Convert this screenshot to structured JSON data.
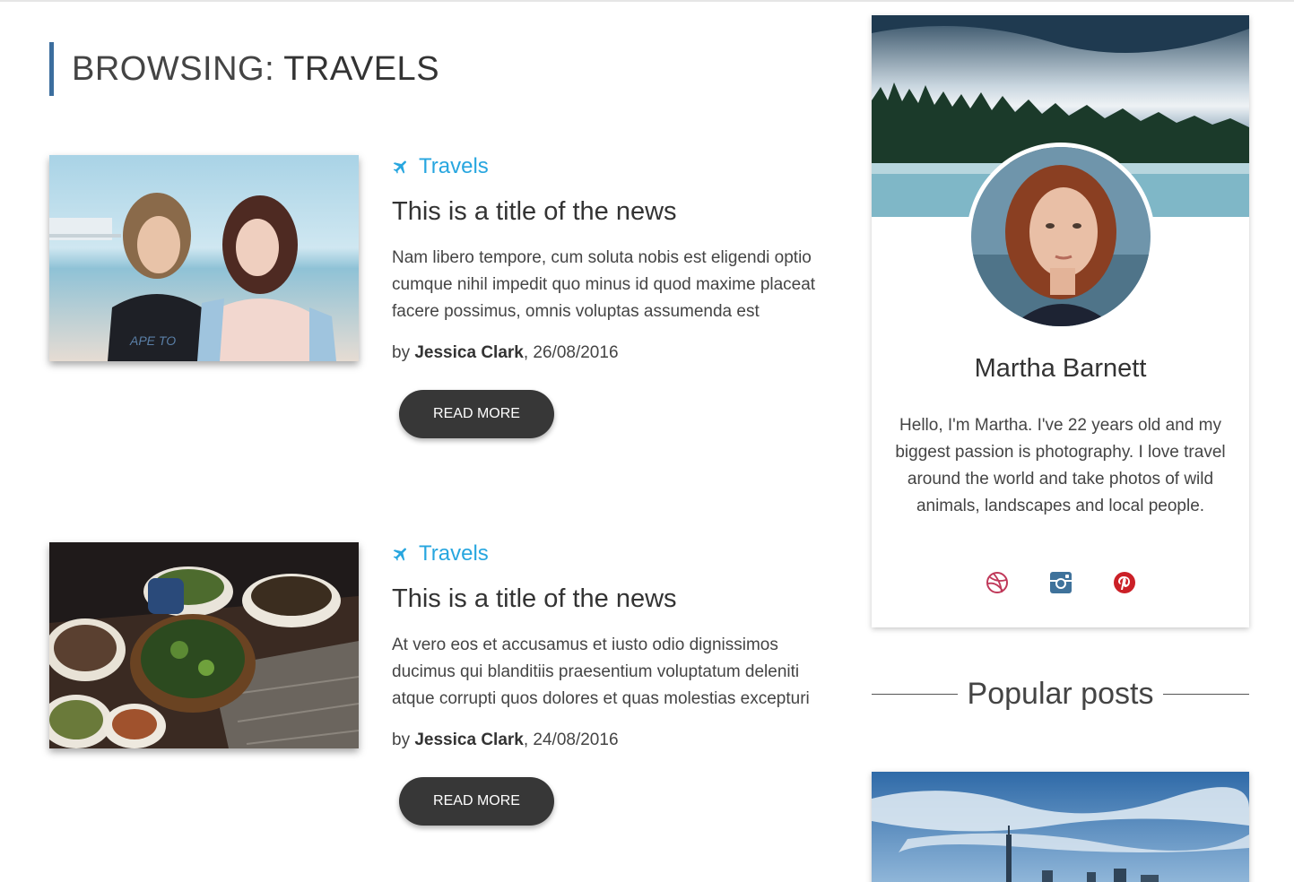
{
  "header": {
    "prefix": "BROWSING:",
    "term": "TRAVELS"
  },
  "posts": [
    {
      "category": "Travels",
      "category_icon": "airplane-icon",
      "title": "This is a title of the news",
      "excerpt": "Nam libero tempore, cum soluta nobis est eligendi optio cumque nihil impedit quo minus id quod maxime placeat facere possimus, omnis voluptas assumenda est",
      "by": "by",
      "author": "Jessica Clark",
      "date": ", 26/08/2016",
      "button": "READ MORE",
      "image": "two-women-beach-photo"
    },
    {
      "category": "Travels",
      "category_icon": "airplane-icon",
      "title": "This is a title of the news",
      "excerpt": "At vero eos et accusamus et iusto odio dignissimos ducimus qui blanditiis praesentium voluptatum deleniti atque corrupti quos dolores et quas molestias excepturi",
      "by": "by",
      "author": "Jessica Clark",
      "date": ", 24/08/2016",
      "button": "READ MORE",
      "image": "food-table-photo"
    }
  ],
  "profile": {
    "name": "Martha Barnett",
    "bio": "Hello, I'm Martha. I've 22 years old and my biggest passion is photography. I love travel around the world and take photos of wild animals, landscapes and local people.",
    "cover": "misty-lake-forest-photo",
    "avatar": "red-haired-woman-portrait",
    "socials": [
      {
        "icon": "dribbble-icon",
        "color": "#c0395a"
      },
      {
        "icon": "instagram-icon",
        "color": "#3f729b"
      },
      {
        "icon": "pinterest-icon",
        "color": "#cb2027"
      }
    ]
  },
  "popular": {
    "title": "Popular posts",
    "image": "city-skyline-photo"
  },
  "colors": {
    "accent": "#27a6df",
    "heading_bar": "#3c6e9e",
    "button": "#373737"
  }
}
